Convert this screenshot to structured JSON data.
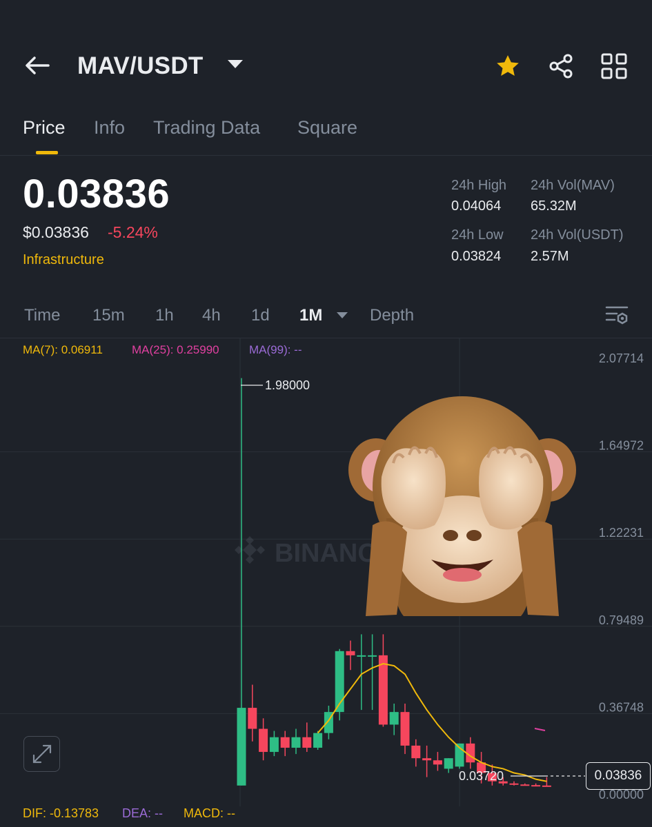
{
  "header": {
    "pair": "MAV/USDT",
    "icons": [
      "back-arrow-icon",
      "star-icon",
      "share-icon",
      "grid-icon"
    ],
    "star_color": "#f0b90b"
  },
  "tabs": [
    {
      "label": "Price",
      "active": true
    },
    {
      "label": "Info",
      "active": false
    },
    {
      "label": "Trading Data",
      "active": false
    },
    {
      "label": "Square",
      "active": false
    }
  ],
  "ticker": {
    "price": "0.03836",
    "price_usd": "$0.03836",
    "change": "-5.24%",
    "category": "Infrastructure",
    "high_label": "24h High",
    "high": "0.04064",
    "vol_mav_label": "24h Vol(MAV)",
    "vol_mav": "65.32M",
    "low_label": "24h Low",
    "low": "0.03824",
    "vol_usdt_label": "24h Vol(USDT)",
    "vol_usdt": "2.57M"
  },
  "intervals": {
    "items": [
      "Time",
      "15m",
      "1h",
      "4h",
      "1d",
      "1M",
      "Depth"
    ],
    "active": "1M"
  },
  "indicators": {
    "ma7": "MA(7): 0.06911",
    "ma25": "MA(25): 0.25990",
    "ma99": "MA(99): --",
    "dif": "DIF: -0.13783",
    "dea": "DEA: --",
    "macd": "MACD: --"
  },
  "watermark": "BINANCE",
  "colors": {
    "up": "#2ebd85",
    "down": "#f6465d",
    "accent": "#f0b90b",
    "ma25": "#e040a0",
    "ma99": "#9b6bd6"
  },
  "chart_data": {
    "type": "candlestick",
    "y_ticks": [
      "2.07714",
      "1.64972",
      "1.22231",
      "0.79489",
      "0.36748",
      "0.00000"
    ],
    "ylim": [
      0,
      2.07714
    ],
    "high_label": "1.98000",
    "low_label": "0.03720",
    "last_price": "0.03836",
    "candles": [
      {
        "o": 0.04,
        "h": 1.98,
        "l": 0.04,
        "c": 0.41
      },
      {
        "o": 0.41,
        "h": 0.52,
        "l": 0.25,
        "c": 0.31
      },
      {
        "o": 0.31,
        "h": 0.36,
        "l": 0.16,
        "c": 0.2
      },
      {
        "o": 0.2,
        "h": 0.3,
        "l": 0.18,
        "c": 0.27
      },
      {
        "o": 0.27,
        "h": 0.3,
        "l": 0.18,
        "c": 0.22
      },
      {
        "o": 0.22,
        "h": 0.31,
        "l": 0.19,
        "c": 0.27
      },
      {
        "o": 0.27,
        "h": 0.34,
        "l": 0.2,
        "c": 0.22
      },
      {
        "o": 0.22,
        "h": 0.3,
        "l": 0.21,
        "c": 0.29
      },
      {
        "o": 0.29,
        "h": 0.42,
        "l": 0.26,
        "c": 0.39
      },
      {
        "o": 0.39,
        "h": 0.69,
        "l": 0.35,
        "c": 0.68
      },
      {
        "o": 0.68,
        "h": 0.73,
        "l": 0.59,
        "c": 0.66
      },
      {
        "o": 0.66,
        "h": 0.76,
        "l": 0.4,
        "c": 0.66
      },
      {
        "o": 0.66,
        "h": 0.76,
        "l": 0.4,
        "c": 0.66
      },
      {
        "o": 0.66,
        "h": 0.76,
        "l": 0.32,
        "c": 0.33
      },
      {
        "o": 0.33,
        "h": 0.43,
        "l": 0.28,
        "c": 0.39
      },
      {
        "o": 0.39,
        "h": 0.43,
        "l": 0.19,
        "c": 0.23
      },
      {
        "o": 0.23,
        "h": 0.26,
        "l": 0.13,
        "c": 0.17
      },
      {
        "o": 0.17,
        "h": 0.23,
        "l": 0.08,
        "c": 0.16
      },
      {
        "o": 0.16,
        "h": 0.2,
        "l": 0.11,
        "c": 0.14
      },
      {
        "o": 0.12,
        "h": 0.17,
        "l": 0.1,
        "c": 0.17
      },
      {
        "o": 0.13,
        "h": 0.24,
        "l": 0.12,
        "c": 0.24
      },
      {
        "o": 0.24,
        "h": 0.27,
        "l": 0.12,
        "c": 0.15
      },
      {
        "o": 0.15,
        "h": 0.2,
        "l": 0.05,
        "c": 0.1
      },
      {
        "o": 0.1,
        "h": 0.14,
        "l": 0.04,
        "c": 0.06
      },
      {
        "o": 0.06,
        "h": 0.08,
        "l": 0.04,
        "c": 0.05
      },
      {
        "o": 0.05,
        "h": 0.06,
        "l": 0.04,
        "c": 0.045
      },
      {
        "o": 0.045,
        "h": 0.05,
        "l": 0.04,
        "c": 0.042
      },
      {
        "o": 0.042,
        "h": 0.05,
        "l": 0.038,
        "c": 0.04
      },
      {
        "o": 0.04,
        "h": 0.08,
        "l": 0.037,
        "c": 0.038
      }
    ],
    "ma7": [
      0.29,
      0.35,
      0.43,
      0.5,
      0.57,
      0.6,
      0.62,
      0.61,
      0.57,
      0.48,
      0.4,
      0.33,
      0.27,
      0.22,
      0.18,
      0.15,
      0.13,
      0.12,
      0.1,
      0.09,
      0.07,
      0.06
    ]
  }
}
